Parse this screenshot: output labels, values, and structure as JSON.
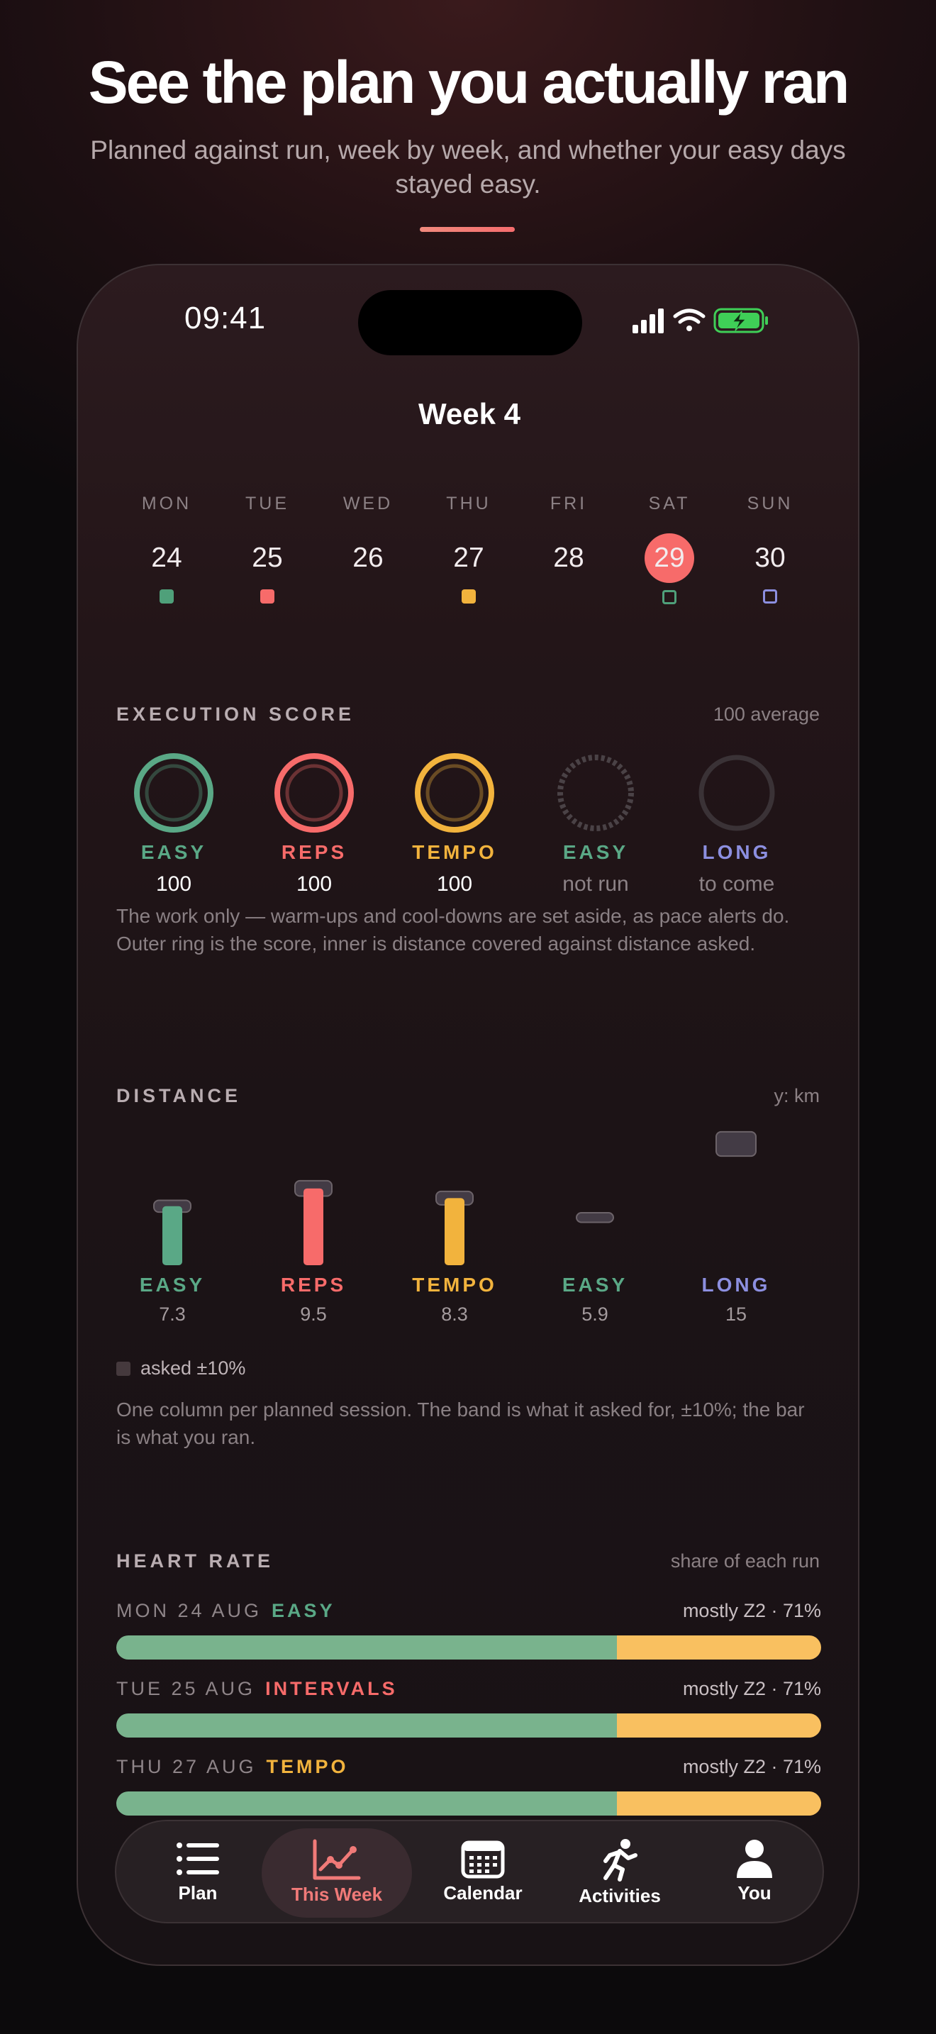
{
  "hero": {
    "title": "See the plan you actually ran",
    "subtitle": "Planned against run, week by week, and whether your easy days stayed easy."
  },
  "status_bar": {
    "time": "09:41",
    "icons": [
      "signal-icon",
      "wifi-icon",
      "battery-charging-icon"
    ]
  },
  "week": {
    "title": "Week 4",
    "days": [
      {
        "dow": "MON",
        "num": "24",
        "dot": "filled",
        "color": "#4fa07a"
      },
      {
        "dow": "TUE",
        "num": "25",
        "dot": "filled",
        "color": "#f76b6a"
      },
      {
        "dow": "WED",
        "num": "26",
        "dot": "none",
        "color": ""
      },
      {
        "dow": "THU",
        "num": "27",
        "dot": "filled",
        "color": "#f2b33d"
      },
      {
        "dow": "FRI",
        "num": "28",
        "dot": "none",
        "color": ""
      },
      {
        "dow": "SAT",
        "num": "29",
        "dot": "outline",
        "color": "#4fa07a",
        "today": true
      },
      {
        "dow": "SUN",
        "num": "30",
        "dot": "outline",
        "color": "#8c8fe0"
      }
    ]
  },
  "execution": {
    "title": "EXECUTION SCORE",
    "summary": "100 average",
    "items": [
      {
        "label": "EASY",
        "value": "100",
        "color": "#5aa886",
        "state": "done"
      },
      {
        "label": "REPS",
        "value": "100",
        "color": "#f76b6a",
        "state": "done"
      },
      {
        "label": "TEMPO",
        "value": "100",
        "color": "#f2b33d",
        "state": "done"
      },
      {
        "label": "EASY",
        "value": "not run",
        "color": "#5aa886",
        "state": "missed"
      },
      {
        "label": "LONG",
        "value": "to come",
        "color": "#8c8fe0",
        "state": "upcoming"
      }
    ],
    "note": "The work only — warm-ups and cool-downs are set aside, as pace alerts do. Outer ring is the score, inner is distance covered against distance asked."
  },
  "distance": {
    "title": "DISTANCE",
    "unit_label": "y: km",
    "legend": "asked ±10%",
    "note": "One column per planned session. The band is what it asked for, ±10%; the bar is what you ran.",
    "chart_data": {
      "type": "bar",
      "categories": [
        "EASY",
        "REPS",
        "TEMPO",
        "EASY",
        "LONG"
      ],
      "series": [
        {
          "name": "asked",
          "values": [
            7.3,
            9.5,
            8.3,
            5.9,
            15
          ]
        },
        {
          "name": "ran",
          "values": [
            7.3,
            9.5,
            8.3,
            0,
            0
          ]
        }
      ],
      "band_pct": 10,
      "colors": [
        "#5aa886",
        "#f76b6a",
        "#f2b33d",
        "#5aa886",
        "#8c8fe0"
      ],
      "ylabel": "km"
    }
  },
  "heart_rate": {
    "title": "HEART RATE",
    "summary": "share of each run",
    "rows": [
      {
        "date": "MON 24 AUG",
        "type": "EASY",
        "type_color": "#5aa886",
        "summary": "mostly Z2 · 71%",
        "z2": 71
      },
      {
        "date": "TUE 25 AUG",
        "type": "INTERVALS",
        "type_color": "#f76b6a",
        "summary": "mostly Z2 · 71%",
        "z2": 71
      },
      {
        "date": "THU 27 AUG",
        "type": "TEMPO",
        "type_color": "#f2b33d",
        "summary": "mostly Z2 · 71%",
        "z2": 71
      }
    ]
  },
  "tabs": [
    {
      "label": "Plan",
      "icon": "list-icon",
      "active": false
    },
    {
      "label": "This Week",
      "icon": "chart-line-icon",
      "active": true
    },
    {
      "label": "Calendar",
      "icon": "calendar-icon",
      "active": false
    },
    {
      "label": "Activities",
      "icon": "runner-icon",
      "active": false
    },
    {
      "label": "You",
      "icon": "person-icon",
      "active": false
    }
  ]
}
